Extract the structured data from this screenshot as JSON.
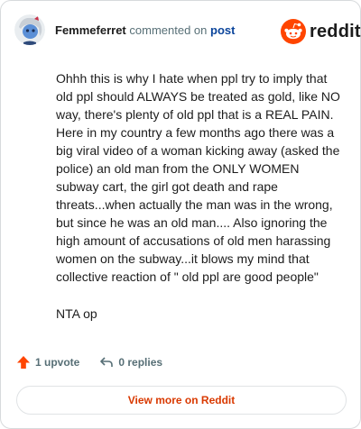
{
  "header": {
    "author": "Femmeferret",
    "action": "commented on",
    "post_link": "post"
  },
  "brand": {
    "name": "reddit",
    "color": "#ff4500"
  },
  "comment": {
    "paragraphs": [
      "Ohhh this is why I hate when ppl try to imply that old ppl should ALWAYS be treated as gold, like NO way, there's plenty of old ppl that is a REAL PAIN. Here in my country a few months ago there was a big viral video of a woman kicking away (asked the police) an old man from the ONLY WOMEN subway cart, the girl got death and rape threats...when actually the man was in the wrong, but since he was an old man.... Also ignoring the high amount of accusations of old men harassing women on the subway...it blows my mind that collective reaction of \" old ppl are good people\"",
      "NTA op"
    ]
  },
  "footer": {
    "upvotes": "1 upvote",
    "replies": "0 replies",
    "upvote_icon": "upvote-arrow-icon",
    "reply_icon": "reply-arrow-icon"
  },
  "view_more": "View more on Reddit",
  "colors": {
    "accent": "#d93900",
    "upvote": "#ff4500",
    "link": "#0a449b"
  }
}
